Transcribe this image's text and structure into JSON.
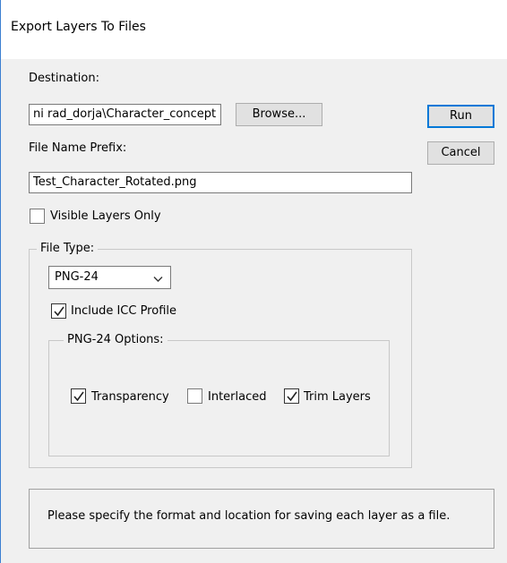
{
  "dialog": {
    "title": "Export Layers To Files"
  },
  "destination": {
    "label": "Destination:",
    "value": "ni rad_dorja\\Character_concept",
    "browse_label": "Browse..."
  },
  "actions": {
    "run_label": "Run",
    "cancel_label": "Cancel"
  },
  "prefix": {
    "label": "File Name Prefix:",
    "value": "Test_Character_Rotated.png"
  },
  "visible_only": {
    "label": "Visible Layers Only",
    "checked": false
  },
  "file_type": {
    "legend": "File Type:",
    "selected": "PNG-24",
    "icc": {
      "label": "Include ICC Profile",
      "checked": true
    }
  },
  "png24_options": {
    "legend": "PNG-24 Options:",
    "transparency": {
      "label": "Transparency",
      "checked": true
    },
    "interlaced": {
      "label": "Interlaced",
      "checked": false
    },
    "trim_layers": {
      "label": "Trim Layers",
      "checked": true
    }
  },
  "message": "Please specify the format and location for saving each layer as a file.",
  "colors": {
    "accent": "#0078d7",
    "window_border": "#3c7fd1"
  }
}
